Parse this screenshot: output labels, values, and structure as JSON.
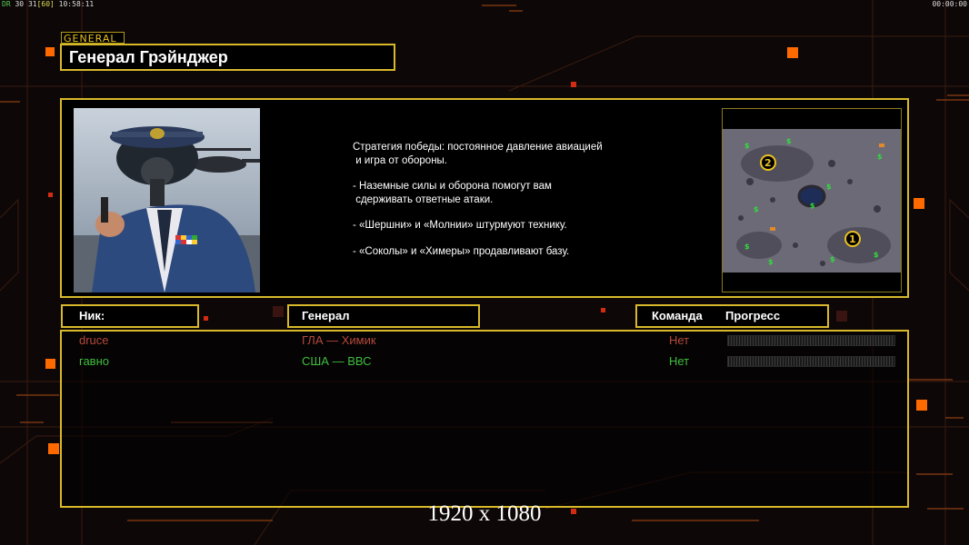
{
  "hud": {
    "left_labels": [
      {
        "text": "DR",
        "color": "#55cc55"
      },
      {
        "text": "30",
        "color": "#ffffff"
      },
      {
        "text": "31",
        "color": "#ffffff"
      },
      {
        "text": "[60]",
        "color": "#dddd55"
      },
      {
        "text": "10:58:11",
        "color": "#ffffff"
      }
    ],
    "right": "00:00:00"
  },
  "header": {
    "tag": "GENERAL",
    "title": "Генерал Грэйнджер"
  },
  "briefing": {
    "lines": [
      "Стратегия победы: постоянное давление авиацией",
      " и игра от обороны.",
      "",
      "- Наземные силы и оборона помогут вам",
      " сдерживать ответные атаки.",
      "",
      "- «Шершни» и «Молнии» штурмуют технику.",
      "",
      "- «Соколы» и «Химеры» продавливают базу."
    ]
  },
  "minimap": {
    "start_positions": [
      "2",
      "1"
    ]
  },
  "table": {
    "headers": {
      "nick": "Ник:",
      "general": "Генерал",
      "team": "Команда",
      "progress": "Прогресс"
    },
    "rows": [
      {
        "nick": "druce",
        "general": "ГЛА — Химик",
        "team": "Нет",
        "progress": 0,
        "color": "#b44a3c"
      },
      {
        "nick": "гавно",
        "general": "США — ВВС",
        "team": "Нет",
        "progress": 0,
        "color": "#3fbf3f"
      }
    ]
  },
  "overlay": {
    "resolution": "1920 x 1080"
  },
  "colors": {
    "accent": "#d8b92a",
    "orange_square": "#ff6a00"
  }
}
